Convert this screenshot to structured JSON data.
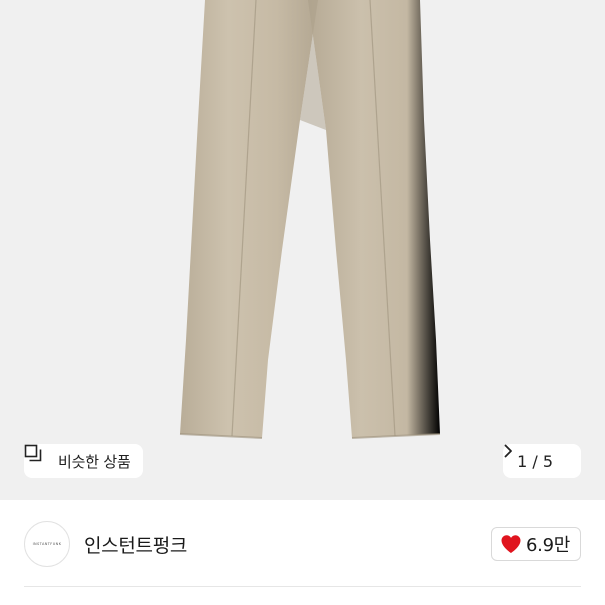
{
  "product": {
    "image_alt": "beige trousers",
    "similar_label": "비슷한 상품",
    "pager_label": "1 / 5",
    "current_image": 1,
    "total_images": 5
  },
  "seller": {
    "store_name": "인스턴트펑크",
    "likes_label": "6.9만",
    "avatar_logo_text": "INSTANTFUNK"
  },
  "icons": {
    "similar": "similar-products-icon",
    "next": "chevron-right-icon",
    "like": "heart-icon"
  },
  "colors": {
    "heart": "#e0141e",
    "image_bg": "#f0f0f0",
    "trousers": "#c8bca8"
  }
}
